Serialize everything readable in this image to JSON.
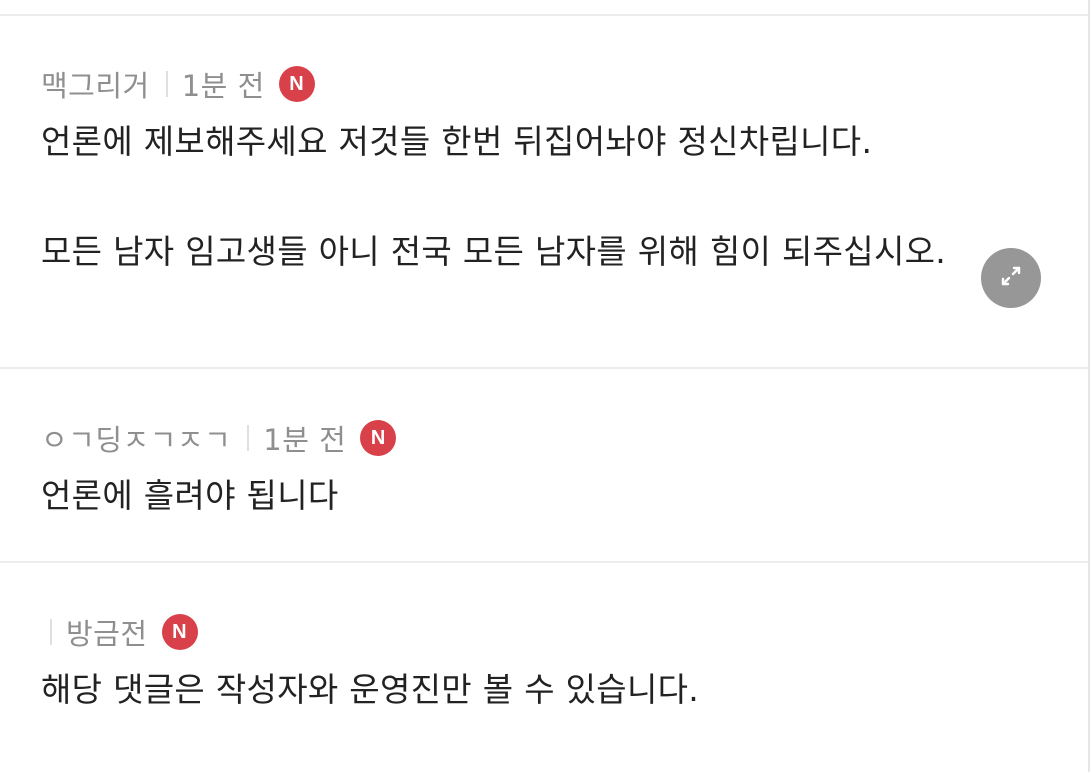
{
  "comments": [
    {
      "author": "맥그리거",
      "time": "1분 전",
      "badge": "N",
      "lines": [
        "언론에 제보해주세요 저것들 한번 뒤집어놔야 정신차립니다.",
        "모든 남자 임고생들 아니 전국 모든 남자를 위해 힘이 되주십시오."
      ]
    },
    {
      "author": "ㅇㄱ딩ㅈㄱㅈㄱ",
      "time": "1분 전",
      "badge": "N",
      "lines": [
        "언론에 흘려야 됩니다"
      ]
    },
    {
      "author": "",
      "time": "방금전",
      "badge": "N",
      "lines": [
        "해당 댓글은 작성자와 운영진만 볼 수 있습니다."
      ]
    }
  ],
  "icons": {
    "expand": "expand-arrows-icon",
    "new_badge": "new-badge-icon"
  },
  "colors": {
    "badge": "#d9414a",
    "meta_text": "#8f8f8f",
    "body_text": "#222222",
    "divider": "#ececec"
  }
}
